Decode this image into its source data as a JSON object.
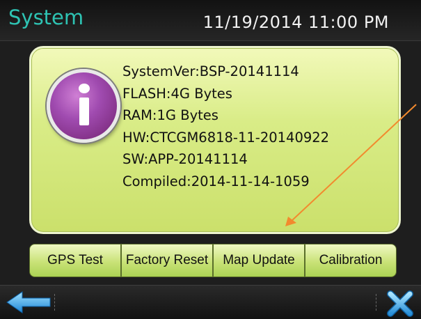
{
  "header": {
    "title": "System",
    "datetime": "11/19/2014 11:00 PM"
  },
  "info": {
    "lines": [
      "SystemVer:BSP-20141114",
      "FLASH:4G Bytes",
      "RAM:1G Bytes",
      "HW:CTCGM6818-11-20140922",
      "SW:APP-20141114",
      "Compiled:2014-11-14-1059"
    ],
    "icon": "info-icon"
  },
  "buttons": [
    "GPS Test",
    "Factory Reset",
    "Map Update",
    "Calibration"
  ],
  "footer": {
    "back_icon": "back-arrow-icon",
    "close_icon": "close-icon"
  },
  "colors": {
    "title": "#2ec3b3",
    "panel": "#d9ec87",
    "icon": "#a04bb0",
    "annotation": "#f28a2e"
  }
}
